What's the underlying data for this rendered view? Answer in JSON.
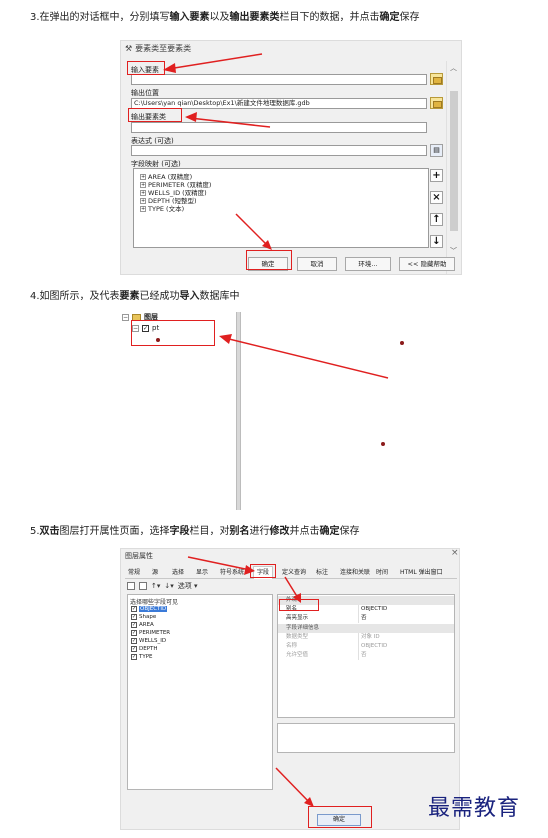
{
  "steps": {
    "step3": {
      "number": "3.",
      "p1": "在弹出的对话框中，分别填写",
      "b1": "输入要素",
      "p2": "以及",
      "b2": "输出要素类",
      "p3": "栏目下的数据，并点击",
      "b3": "确定",
      "p4": "保存"
    },
    "step4": {
      "number": "4.",
      "p1": "如图所示，及代表",
      "b1": "要素",
      "p2": "已经成功",
      "b2": "导入",
      "p3": "数据库中"
    },
    "step5": {
      "number": "5.",
      "b1": "双击",
      "p1": "图层打开属性页面，选择",
      "b2": "字段",
      "p2": "栏目，对",
      "b3": "别名",
      "p3": "进行",
      "b4": "修改",
      "p4": "并点击",
      "b5": "确定",
      "p5": "保存"
    }
  },
  "dialog1": {
    "title": "要素类至要素类",
    "input_label": "输入要素",
    "input_value": "",
    "output_location_label": "输出位置",
    "output_location_value": "C:\\Users\\yan qian\\Desktop\\Ex1\\新建文件地理数据库.gdb",
    "output_class_label": "输出要素类",
    "output_class_value": "",
    "expression_label": "表达式 (可选)",
    "expression_value": "",
    "field_map_label": "字段映射 (可选)",
    "fields": [
      "AREA (双精度)",
      "PERIMETER (双精度)",
      "WELLS_ID (双精度)",
      "DEPTH (短整型)",
      "TYPE (文本)"
    ],
    "side_buttons": {
      "add": "+",
      "remove": "×",
      "up": "↑",
      "down": "↓"
    },
    "buttons": {
      "ok": "确定",
      "cancel": "取消",
      "env": "环境...",
      "help": "<< 隐藏帮助"
    }
  },
  "toc": {
    "root": "图层",
    "layer": "pt"
  },
  "dialog3": {
    "title": "图层属性",
    "close": "×",
    "tabs": [
      "常规",
      "源",
      "选择",
      "显示",
      "符号系统",
      "字段",
      "定义查询",
      "标注",
      "连接和关联",
      "时间",
      "HTML 弹出窗口"
    ],
    "active_tab": "字段",
    "toolbar_options": "选项 ▾",
    "left_header": "选择哪些字段可见",
    "fields": [
      "OBJECTID",
      "Shape",
      "AREA",
      "PERIMETER",
      "WELLS_ID",
      "DEPTH",
      "TYPE"
    ],
    "selected_field": "OBJECTID",
    "prop_group1": "外观",
    "props_appearance": [
      {
        "key": "别名",
        "value": "OBJECTID"
      },
      {
        "key": "高亮显示",
        "value": "否"
      }
    ],
    "prop_group2": "字段详细信息",
    "props_details": [
      {
        "key": "数据类型",
        "value": "对象 ID"
      },
      {
        "key": "名称",
        "value": "OBJECTID"
      },
      {
        "key": "允许空值",
        "value": "否"
      }
    ],
    "ok": "确定"
  },
  "watermark": "最需教育",
  "colors": {
    "annotation_red": "#e02020",
    "point_color": "#8b1a1a",
    "watermark": "#1a237e"
  }
}
